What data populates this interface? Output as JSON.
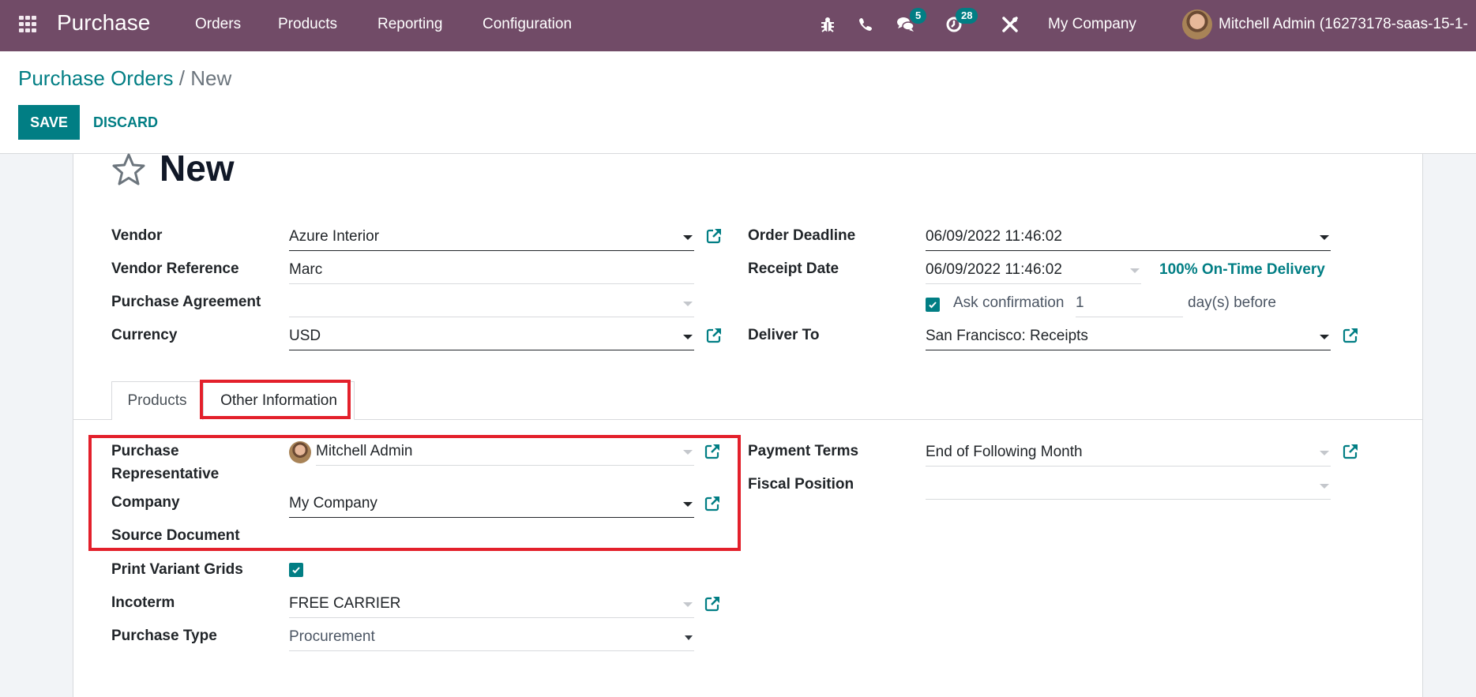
{
  "navbar": {
    "app_name": "Purchase",
    "menu": [
      "Orders",
      "Products",
      "Reporting",
      "Configuration"
    ],
    "icons": [
      "apps-grid-icon",
      "bug-icon",
      "phone-icon",
      "chat-icon",
      "activity-clock-icon",
      "tools-icon"
    ],
    "messages_badge": "5",
    "activities_badge": "28",
    "company": "My Company",
    "user": "Mitchell Admin (16273178-saas-15-1-"
  },
  "breadcrumb": {
    "parent": "Purchase Orders",
    "separator": "/",
    "current": "New"
  },
  "actions": {
    "save": "SAVE",
    "discard": "DISCARD"
  },
  "form": {
    "title": "New",
    "left": {
      "vendor": {
        "label": "Vendor",
        "value": "Azure Interior"
      },
      "vendor_reference": {
        "label": "Vendor Reference",
        "value": "Marc"
      },
      "purchase_agreement": {
        "label": "Purchase Agreement",
        "value": ""
      },
      "currency": {
        "label": "Currency",
        "value": "USD"
      }
    },
    "right": {
      "order_deadline": {
        "label": "Order Deadline",
        "value": "06/09/2022 11:46:02"
      },
      "receipt_date": {
        "label": "Receipt Date",
        "value": "06/09/2022 11:46:02"
      },
      "on_time_delivery": "100% On-Time Delivery",
      "ask_confirmation": {
        "label": "Ask confirmation",
        "checked": true,
        "days": "1",
        "suffix": "day(s) before"
      },
      "deliver_to": {
        "label": "Deliver To",
        "value": "San Francisco: Receipts"
      }
    }
  },
  "tabs": [
    {
      "label": "Products",
      "active": false
    },
    {
      "label": "Other Information",
      "active": true
    }
  ],
  "other_info": {
    "left": {
      "purchase_representative": {
        "label": "Purchase Representative",
        "value": "Mitchell Admin"
      },
      "company": {
        "label": "Company",
        "value": "My Company"
      },
      "source_document": {
        "label": "Source Document",
        "value": ""
      },
      "print_variant_grids": {
        "label": "Print Variant Grids",
        "checked": true
      },
      "incoterm": {
        "label": "Incoterm",
        "value": "FREE CARRIER"
      },
      "purchase_type": {
        "label": "Purchase Type",
        "value": "Procurement"
      }
    },
    "right": {
      "payment_terms": {
        "label": "Payment Terms",
        "value": "End of Following Month"
      },
      "fiscal_position": {
        "label": "Fiscal Position",
        "value": ""
      }
    }
  },
  "colors": {
    "navbar": "#714B67",
    "accent": "#017e84",
    "highlight": "#e3202b"
  }
}
